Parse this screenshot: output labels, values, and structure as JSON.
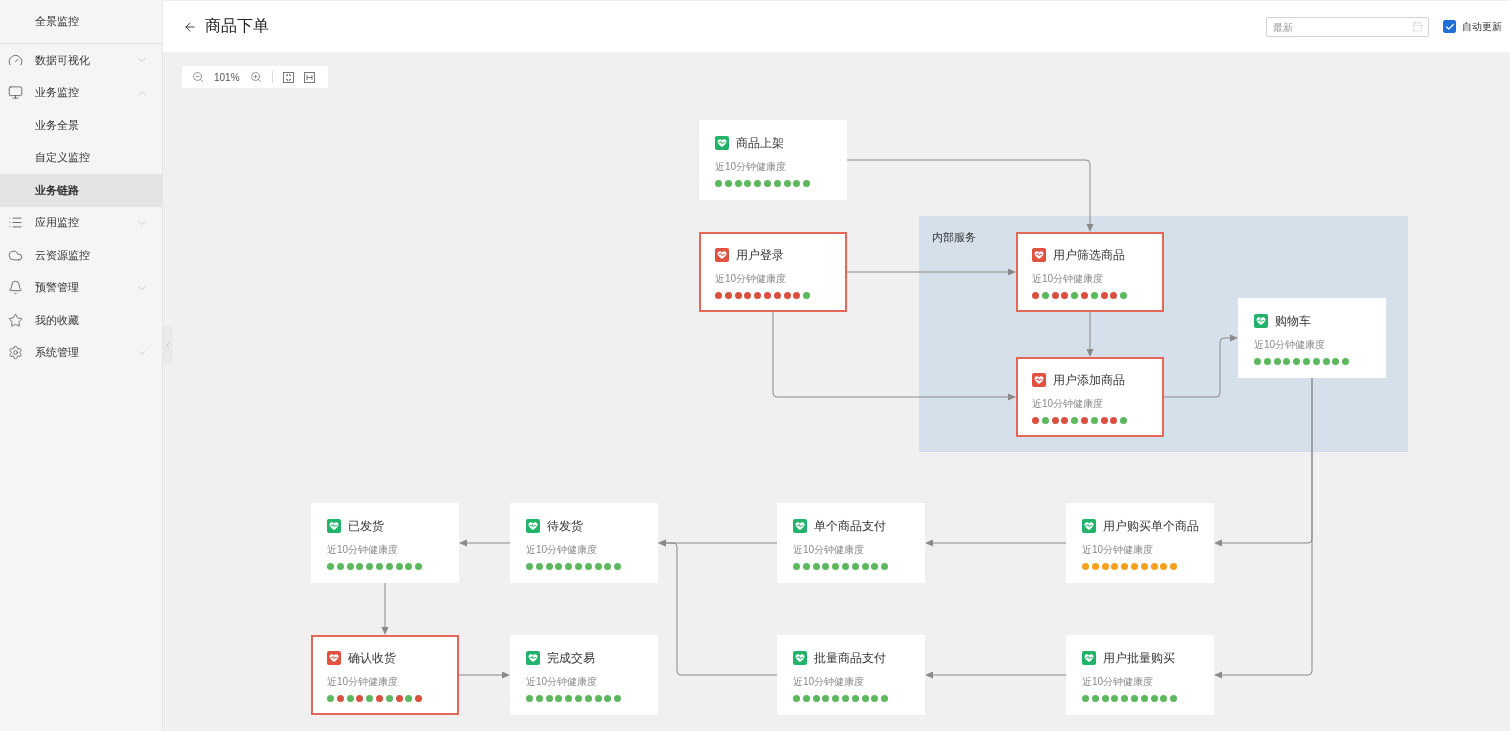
{
  "sidebar": {
    "title": "全景监控",
    "items": [
      {
        "label": "数据可视化",
        "kind": "group",
        "expanded": false,
        "selected": false
      },
      {
        "label": "业务监控",
        "kind": "group",
        "expanded": true,
        "selected": false,
        "children": [
          {
            "label": "业务全景",
            "selected": false
          },
          {
            "label": "自定义监控",
            "selected": false
          },
          {
            "label": "业务链路",
            "selected": true
          }
        ]
      },
      {
        "label": "应用监控",
        "kind": "group",
        "expanded": false,
        "selected": false
      },
      {
        "label": "云资源监控",
        "kind": "link",
        "selected": false
      },
      {
        "label": "预警管理",
        "kind": "group",
        "expanded": false,
        "selected": false
      },
      {
        "label": "我的收藏",
        "kind": "link",
        "selected": false
      },
      {
        "label": "系统管理",
        "kind": "group",
        "expanded": false,
        "selected": false
      }
    ]
  },
  "header": {
    "title": "商品下单",
    "time_field": {
      "placeholder": "最新"
    },
    "auto_refresh": {
      "label": "自动更新",
      "checked": true
    }
  },
  "toolbar": {
    "zoom": "101%"
  },
  "diagram": {
    "group": {
      "label": "内部服务"
    },
    "nodes": [
      {
        "title": "商品上架",
        "subtitle": "近10分钟健康度",
        "alert": false,
        "dots": [
          {
            "color": "#5cb85c"
          },
          {
            "color": "#5cb85c"
          },
          {
            "color": "#5cb85c"
          },
          {
            "color": "#5cb85c"
          },
          {
            "color": "#5cb85c"
          },
          {
            "color": "#5cb85c"
          },
          {
            "color": "#5cb85c"
          },
          {
            "color": "#5cb85c"
          },
          {
            "color": "#5cb85c"
          },
          {
            "color": "#5cb85c"
          }
        ]
      },
      {
        "title": "用户登录",
        "subtitle": "近10分钟健康度",
        "alert": true,
        "dots": [
          {
            "color": "#d9503f"
          },
          {
            "color": "#d9503f"
          },
          {
            "color": "#d9503f"
          },
          {
            "color": "#d9503f"
          },
          {
            "color": "#d9503f"
          },
          {
            "color": "#d9503f"
          },
          {
            "color": "#d9503f"
          },
          {
            "color": "#d9503f"
          },
          {
            "color": "#d9503f"
          },
          {
            "color": "#5cb85c"
          }
        ]
      },
      {
        "title": "用户筛选商品",
        "subtitle": "近10分钟健康度",
        "alert": true,
        "dots": [
          {
            "color": "#d9503f"
          },
          {
            "color": "#5cb85c"
          },
          {
            "color": "#d9503f"
          },
          {
            "color": "#d9503f"
          },
          {
            "color": "#5cb85c"
          },
          {
            "color": "#d9503f"
          },
          {
            "color": "#5cb85c"
          },
          {
            "color": "#d9503f"
          },
          {
            "color": "#d9503f"
          },
          {
            "color": "#5cb85c"
          }
        ]
      },
      {
        "title": "购物车",
        "subtitle": "近10分钟健康度",
        "alert": false,
        "dots": [
          {
            "color": "#5cb85c"
          },
          {
            "color": "#5cb85c"
          },
          {
            "color": "#5cb85c"
          },
          {
            "color": "#5cb85c"
          },
          {
            "color": "#5cb85c"
          },
          {
            "color": "#5cb85c"
          },
          {
            "color": "#5cb85c"
          },
          {
            "color": "#5cb85c"
          },
          {
            "color": "#5cb85c"
          },
          {
            "color": "#5cb85c"
          }
        ]
      },
      {
        "title": "用户添加商品",
        "subtitle": "近10分钟健康度",
        "alert": true,
        "dots": [
          {
            "color": "#d9503f"
          },
          {
            "color": "#5cb85c"
          },
          {
            "color": "#d9503f"
          },
          {
            "color": "#d9503f"
          },
          {
            "color": "#5cb85c"
          },
          {
            "color": "#d9503f"
          },
          {
            "color": "#5cb85c"
          },
          {
            "color": "#d9503f"
          },
          {
            "color": "#d9503f"
          },
          {
            "color": "#5cb85c"
          }
        ]
      },
      {
        "title": "已发货",
        "subtitle": "近10分钟健康度",
        "alert": false,
        "dots": [
          {
            "color": "#5cb85c"
          },
          {
            "color": "#5cb85c"
          },
          {
            "color": "#5cb85c"
          },
          {
            "color": "#5cb85c"
          },
          {
            "color": "#5cb85c"
          },
          {
            "color": "#5cb85c"
          },
          {
            "color": "#5cb85c"
          },
          {
            "color": "#5cb85c"
          },
          {
            "color": "#5cb85c"
          },
          {
            "color": "#5cb85c"
          }
        ]
      },
      {
        "title": "待发货",
        "subtitle": "近10分钟健康度",
        "alert": false,
        "dots": [
          {
            "color": "#5cb85c"
          },
          {
            "color": "#5cb85c"
          },
          {
            "color": "#5cb85c"
          },
          {
            "color": "#5cb85c"
          },
          {
            "color": "#5cb85c"
          },
          {
            "color": "#5cb85c"
          },
          {
            "color": "#5cb85c"
          },
          {
            "color": "#5cb85c"
          },
          {
            "color": "#5cb85c"
          },
          {
            "color": "#5cb85c"
          }
        ]
      },
      {
        "title": "单个商品支付",
        "subtitle": "近10分钟健康度",
        "alert": false,
        "dots": [
          {
            "color": "#5cb85c"
          },
          {
            "color": "#5cb85c"
          },
          {
            "color": "#5cb85c"
          },
          {
            "color": "#5cb85c"
          },
          {
            "color": "#5cb85c"
          },
          {
            "color": "#5cb85c"
          },
          {
            "color": "#5cb85c"
          },
          {
            "color": "#5cb85c"
          },
          {
            "color": "#5cb85c"
          },
          {
            "color": "#5cb85c"
          }
        ]
      },
      {
        "title": "用户购买单个商品",
        "subtitle": "近10分钟健康度",
        "alert": false,
        "dots": [
          {
            "color": "#f5a11f"
          },
          {
            "color": "#f5a11f"
          },
          {
            "color": "#f5a11f"
          },
          {
            "color": "#f5a11f"
          },
          {
            "color": "#f5a11f"
          },
          {
            "color": "#f5a11f"
          },
          {
            "color": "#f5a11f"
          },
          {
            "color": "#f5a11f"
          },
          {
            "color": "#f5a11f"
          },
          {
            "color": "#f5a11f"
          }
        ]
      },
      {
        "title": "确认收货",
        "subtitle": "近10分钟健康度",
        "alert": true,
        "dots": [
          {
            "color": "#5cb85c"
          },
          {
            "color": "#d9503f"
          },
          {
            "color": "#5cb85c"
          },
          {
            "color": "#d9503f"
          },
          {
            "color": "#5cb85c"
          },
          {
            "color": "#d9503f"
          },
          {
            "color": "#5cb85c"
          },
          {
            "color": "#d9503f"
          },
          {
            "color": "#5cb85c"
          },
          {
            "color": "#d9503f"
          }
        ]
      },
      {
        "title": "完成交易",
        "subtitle": "近10分钟健康度",
        "alert": false,
        "dots": [
          {
            "color": "#5cb85c"
          },
          {
            "color": "#5cb85c"
          },
          {
            "color": "#5cb85c"
          },
          {
            "color": "#5cb85c"
          },
          {
            "color": "#5cb85c"
          },
          {
            "color": "#5cb85c"
          },
          {
            "color": "#5cb85c"
          },
          {
            "color": "#5cb85c"
          },
          {
            "color": "#5cb85c"
          },
          {
            "color": "#5cb85c"
          }
        ]
      },
      {
        "title": "批量商品支付",
        "subtitle": "近10分钟健康度",
        "alert": false,
        "dots": [
          {
            "color": "#5cb85c"
          },
          {
            "color": "#5cb85c"
          },
          {
            "color": "#5cb85c"
          },
          {
            "color": "#5cb85c"
          },
          {
            "color": "#5cb85c"
          },
          {
            "color": "#5cb85c"
          },
          {
            "color": "#5cb85c"
          },
          {
            "color": "#5cb85c"
          },
          {
            "color": "#5cb85c"
          },
          {
            "color": "#5cb85c"
          }
        ]
      },
      {
        "title": "用户批量购买",
        "subtitle": "近10分钟健康度",
        "alert": false,
        "dots": [
          {
            "color": "#5cb85c"
          },
          {
            "color": "#5cb85c"
          },
          {
            "color": "#5cb85c"
          },
          {
            "color": "#5cb85c"
          },
          {
            "color": "#5cb85c"
          },
          {
            "color": "#5cb85c"
          },
          {
            "color": "#5cb85c"
          },
          {
            "color": "#5cb85c"
          },
          {
            "color": "#5cb85c"
          },
          {
            "color": "#5cb85c"
          }
        ]
      }
    ]
  }
}
